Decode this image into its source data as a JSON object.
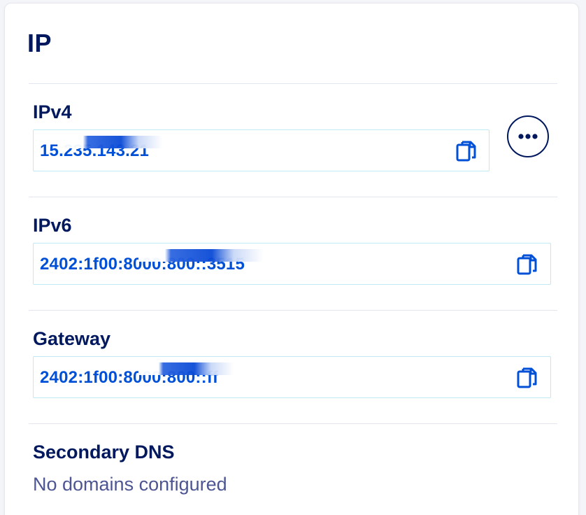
{
  "title": "IP",
  "ipv4": {
    "label": "IPv4",
    "value": "15.235.143.21",
    "copy_icon": "copy-icon"
  },
  "more_actions_icon": "ellipsis-icon",
  "ipv6": {
    "label": "IPv6",
    "value": "2402:1f00:8000:800::3515",
    "copy_icon": "copy-icon"
  },
  "gateway": {
    "label": "Gateway",
    "value": "2402:1f00:8000:800::ff",
    "copy_icon": "copy-icon"
  },
  "secondary_dns": {
    "label": "Secondary DNS",
    "empty_text": "No domains configured"
  },
  "colors": {
    "heading": "#00185e",
    "link_value": "#0050d7",
    "field_border": "#bfe9f3",
    "muted_text": "#4d5693"
  }
}
